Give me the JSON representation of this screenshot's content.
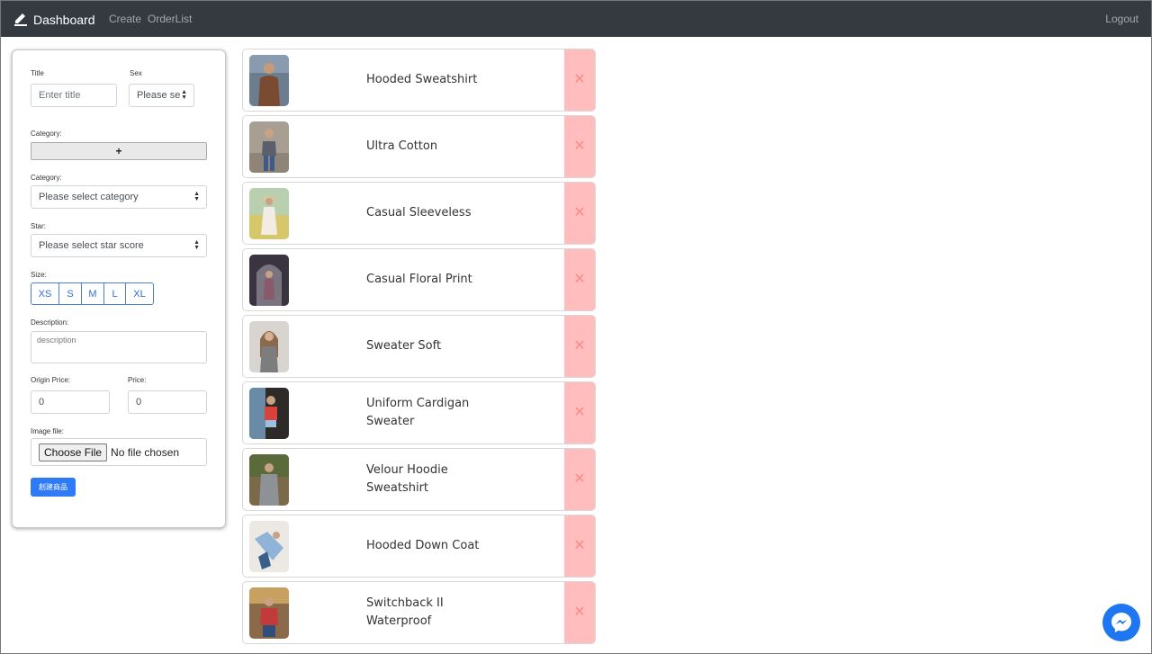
{
  "navbar": {
    "brand": "Dashboard",
    "links": [
      "Create",
      "OrderList"
    ],
    "logout": "Logout"
  },
  "form": {
    "title_label": "Title",
    "title_placeholder": "Enter title",
    "sex_label": "Sex",
    "sex_value": "Please se",
    "category_add_label": "Category:",
    "add_button": "+",
    "category_label": "Category:",
    "category_value": "Please select category",
    "star_label": "Star:",
    "star_value": "Please select star score",
    "size_label": "Size:",
    "sizes": [
      "XS",
      "S",
      "M",
      "L",
      "XL"
    ],
    "description_label": "Description:",
    "description_placeholder": "description",
    "origin_price_label": "Origin Price:",
    "origin_price_value": "0",
    "price_label": "Price:",
    "price_value": "0",
    "image_label": "Image file:",
    "choose_file": "Choose File",
    "no_file": "No file chosen",
    "submit": "創建商品"
  },
  "products": [
    {
      "title": "Hooded Sweatshirt",
      "delete": "✕"
    },
    {
      "title": "Ultra Cotton",
      "delete": "✕"
    },
    {
      "title": "Casual Sleeveless",
      "delete": "✕"
    },
    {
      "title": "Casual Floral Print",
      "delete": "✕"
    },
    {
      "title": "Sweater Soft",
      "delete": "✕"
    },
    {
      "title": "Uniform Cardigan Sweater",
      "delete": "✕"
    },
    {
      "title": "Velour Hoodie Sweatshirt",
      "delete": "✕"
    },
    {
      "title": "Hooded Down Coat",
      "delete": "✕"
    },
    {
      "title": "Switchback II Waterproof",
      "delete": "✕"
    }
  ],
  "colors": {
    "navbar": "#343a40",
    "accent": "#2f7af5",
    "delete_bg": "#ffbdbd",
    "delete_icon": "#ff8a8a",
    "messenger": "#1e76f0"
  }
}
